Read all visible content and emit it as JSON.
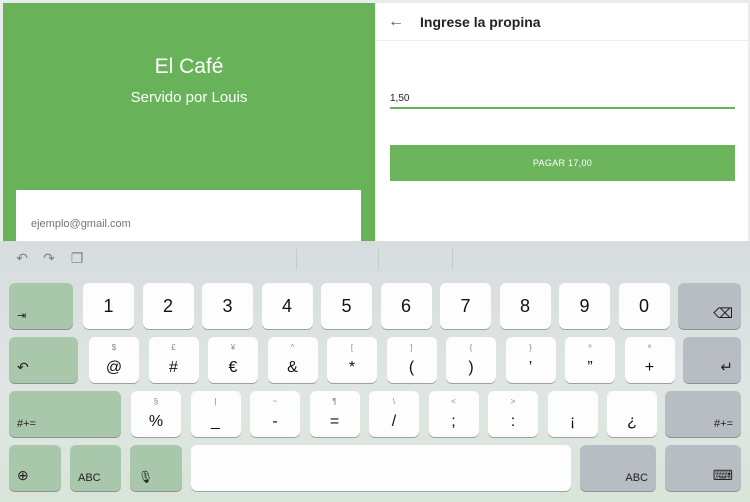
{
  "left": {
    "shop_name": "El Café",
    "served_by": "Servido por Louis",
    "email_placeholder": "ejemplo@gmail.com"
  },
  "right": {
    "title": "Ingrese la propina",
    "tip_value": "1,50",
    "pay_label": "PAGAR 17,00"
  },
  "keyboard": {
    "toolbar_icons": [
      "undo-icon",
      "redo-icon",
      "clipboard-icon"
    ],
    "row1": [
      "1",
      "2",
      "3",
      "4",
      "5",
      "6",
      "7",
      "8",
      "9",
      "0"
    ],
    "row2_main": [
      "@",
      "#",
      "€",
      "&",
      "*",
      "(",
      ")",
      "’",
      "”",
      "+"
    ],
    "row2_sub": [
      "$",
      "£",
      "¥",
      "^",
      "[",
      "]",
      "{",
      "}",
      "º",
      "ª"
    ],
    "row3_main": [
      "%",
      "_",
      "-",
      "=",
      "/",
      ";",
      ":",
      "¡",
      "¿"
    ],
    "row3_sub": [
      "§",
      "|",
      "~",
      "¶",
      "\\",
      "<",
      ">",
      "",
      ""
    ],
    "tab_glyph": "⇥",
    "backspace_glyph": "⌫",
    "undo_glyph": "↶",
    "enter_glyph": "↵",
    "shift_left": "#+=",
    "shift_right": "#+=",
    "abc_left": "ABC",
    "abc_right": "ABC",
    "globe_glyph": "⊕",
    "mic_glyph": "🎙",
    "hide_kb_glyph": "⌨"
  }
}
